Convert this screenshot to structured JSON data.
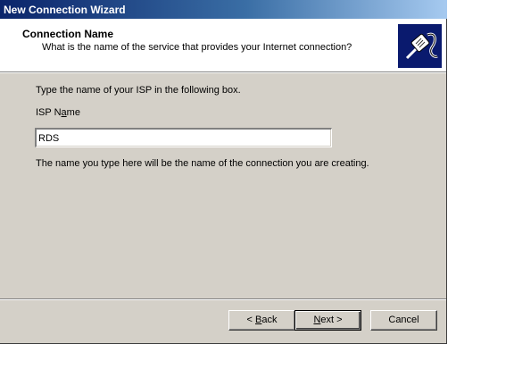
{
  "window": {
    "title": "New Connection Wizard"
  },
  "header": {
    "title": "Connection Name",
    "subtitle": "What is the name of the service that provides your Internet connection?",
    "icon": "network-cable-icon"
  },
  "body": {
    "instruction": "Type the name of your ISP in the following box.",
    "isp_label": {
      "pre": "ISP N",
      "accel": "a",
      "post": "me"
    },
    "isp_value": "RDS",
    "note": "The name you type here will be the name of the connection you are creating."
  },
  "buttons": {
    "back": {
      "pre": "< ",
      "accel": "B",
      "post": "ack"
    },
    "next": {
      "pre": "",
      "accel": "N",
      "post": "ext >"
    },
    "cancel": "Cancel"
  },
  "colors": {
    "titlebar_start": "#0a246a",
    "titlebar_end": "#a6caf0",
    "face": "#d4d0c8",
    "logo_bg": "#0a1a6e"
  }
}
